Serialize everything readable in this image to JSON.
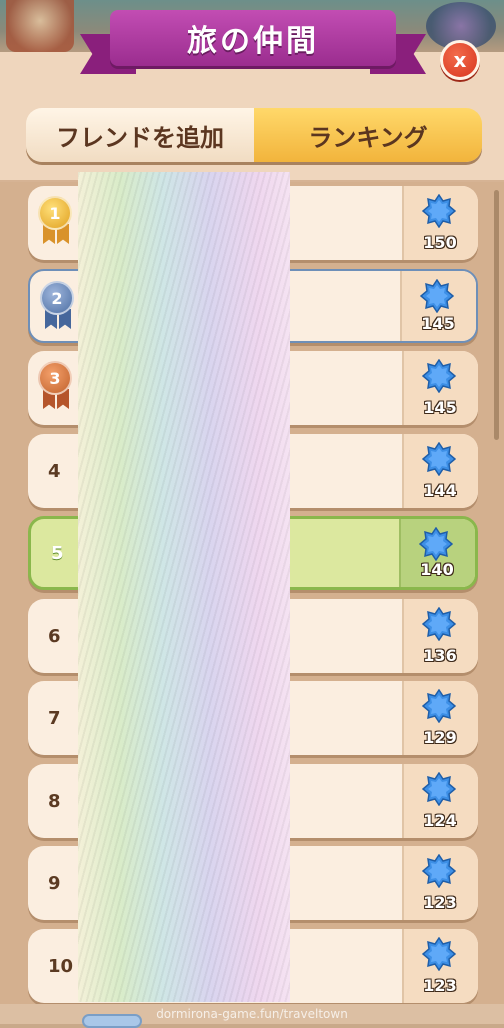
{
  "header": {
    "title": "旅の仲間",
    "close_label": "x"
  },
  "tabs": [
    {
      "label": "フレンドを追加",
      "active": false
    },
    {
      "label": "ランキング",
      "active": true
    }
  ],
  "ranking": [
    {
      "rank": "1",
      "score": "150",
      "medal": "gold"
    },
    {
      "rank": "2",
      "score": "145",
      "medal": "blue"
    },
    {
      "rank": "3",
      "score": "145",
      "medal": "bronze"
    },
    {
      "rank": "4",
      "score": "144"
    },
    {
      "rank": "5",
      "score": "140",
      "is_self": true
    },
    {
      "rank": "6",
      "score": "136"
    },
    {
      "rank": "7",
      "score": "129"
    },
    {
      "rank": "8",
      "score": "124"
    },
    {
      "rank": "9",
      "score": "123"
    },
    {
      "rank": "10",
      "score": "123"
    }
  ],
  "watermark": "dormirona-game.fun/traveltown",
  "colors": {
    "ribbon": "#b23ea5",
    "active_tab": "#f7c24d",
    "self_row": "#dce89f",
    "gem": "#3d8fe6"
  },
  "icons": {
    "score_icon": "blue-star-gem-icon",
    "close_icon": "close-icon"
  }
}
